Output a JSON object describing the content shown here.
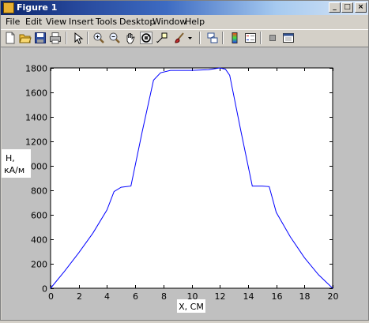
{
  "window": {
    "title": "Figure 1",
    "controls": {
      "minimize": "_",
      "maximize": "□",
      "close": "×"
    }
  },
  "menubar": {
    "items": [
      {
        "label": "File"
      },
      {
        "label": "Edit"
      },
      {
        "label": "View"
      },
      {
        "label": "Insert"
      },
      {
        "label": "Tools"
      },
      {
        "label": "Desktop"
      },
      {
        "label": "Window"
      },
      {
        "label": "Help"
      }
    ]
  },
  "toolbar": {
    "icons": [
      "new-figure-icon",
      "open-file-icon",
      "save-icon",
      "print-icon",
      "edit-plot-arrow-icon",
      "zoom-in-icon",
      "zoom-out-icon",
      "pan-hand-icon",
      "rotate-3d-icon",
      "data-cursor-icon",
      "brush-icon",
      "brush-dropdown-icon",
      "link-plot-icon",
      "colorbar-icon",
      "legend-icon",
      "hide-plot-tools-icon",
      "show-plot-tools-icon"
    ]
  },
  "chart_data": {
    "type": "line",
    "title": "",
    "xlabel": "X, CM",
    "ylabel": "H, кА/м",
    "ylabel_lines": [
      "H,",
      "кА/м"
    ],
    "xlim": [
      0,
      20
    ],
    "ylim": [
      0,
      1800
    ],
    "xticks": [
      0,
      2,
      4,
      6,
      8,
      10,
      12,
      14,
      16,
      18,
      20
    ],
    "yticks": [
      0,
      200,
      400,
      600,
      800,
      1000,
      1200,
      1400,
      1600,
      1800
    ],
    "grid": false,
    "legend": "none",
    "line_color": "#0000ff",
    "series": [
      {
        "x": [
          0,
          1,
          2,
          3,
          4,
          4.5,
          5,
          5.7,
          6.5,
          7.3,
          7.8,
          8.5,
          10,
          11.2,
          12,
          12.4,
          12.7,
          13.5,
          14.3,
          15,
          15.5,
          16,
          17,
          18,
          19,
          20
        ],
        "y": [
          0,
          140,
          290,
          450,
          640,
          790,
          825,
          835,
          1280,
          1700,
          1760,
          1780,
          1780,
          1785,
          1800,
          1790,
          1740,
          1280,
          835,
          835,
          830,
          620,
          420,
          250,
          110,
          0
        ]
      }
    ]
  }
}
